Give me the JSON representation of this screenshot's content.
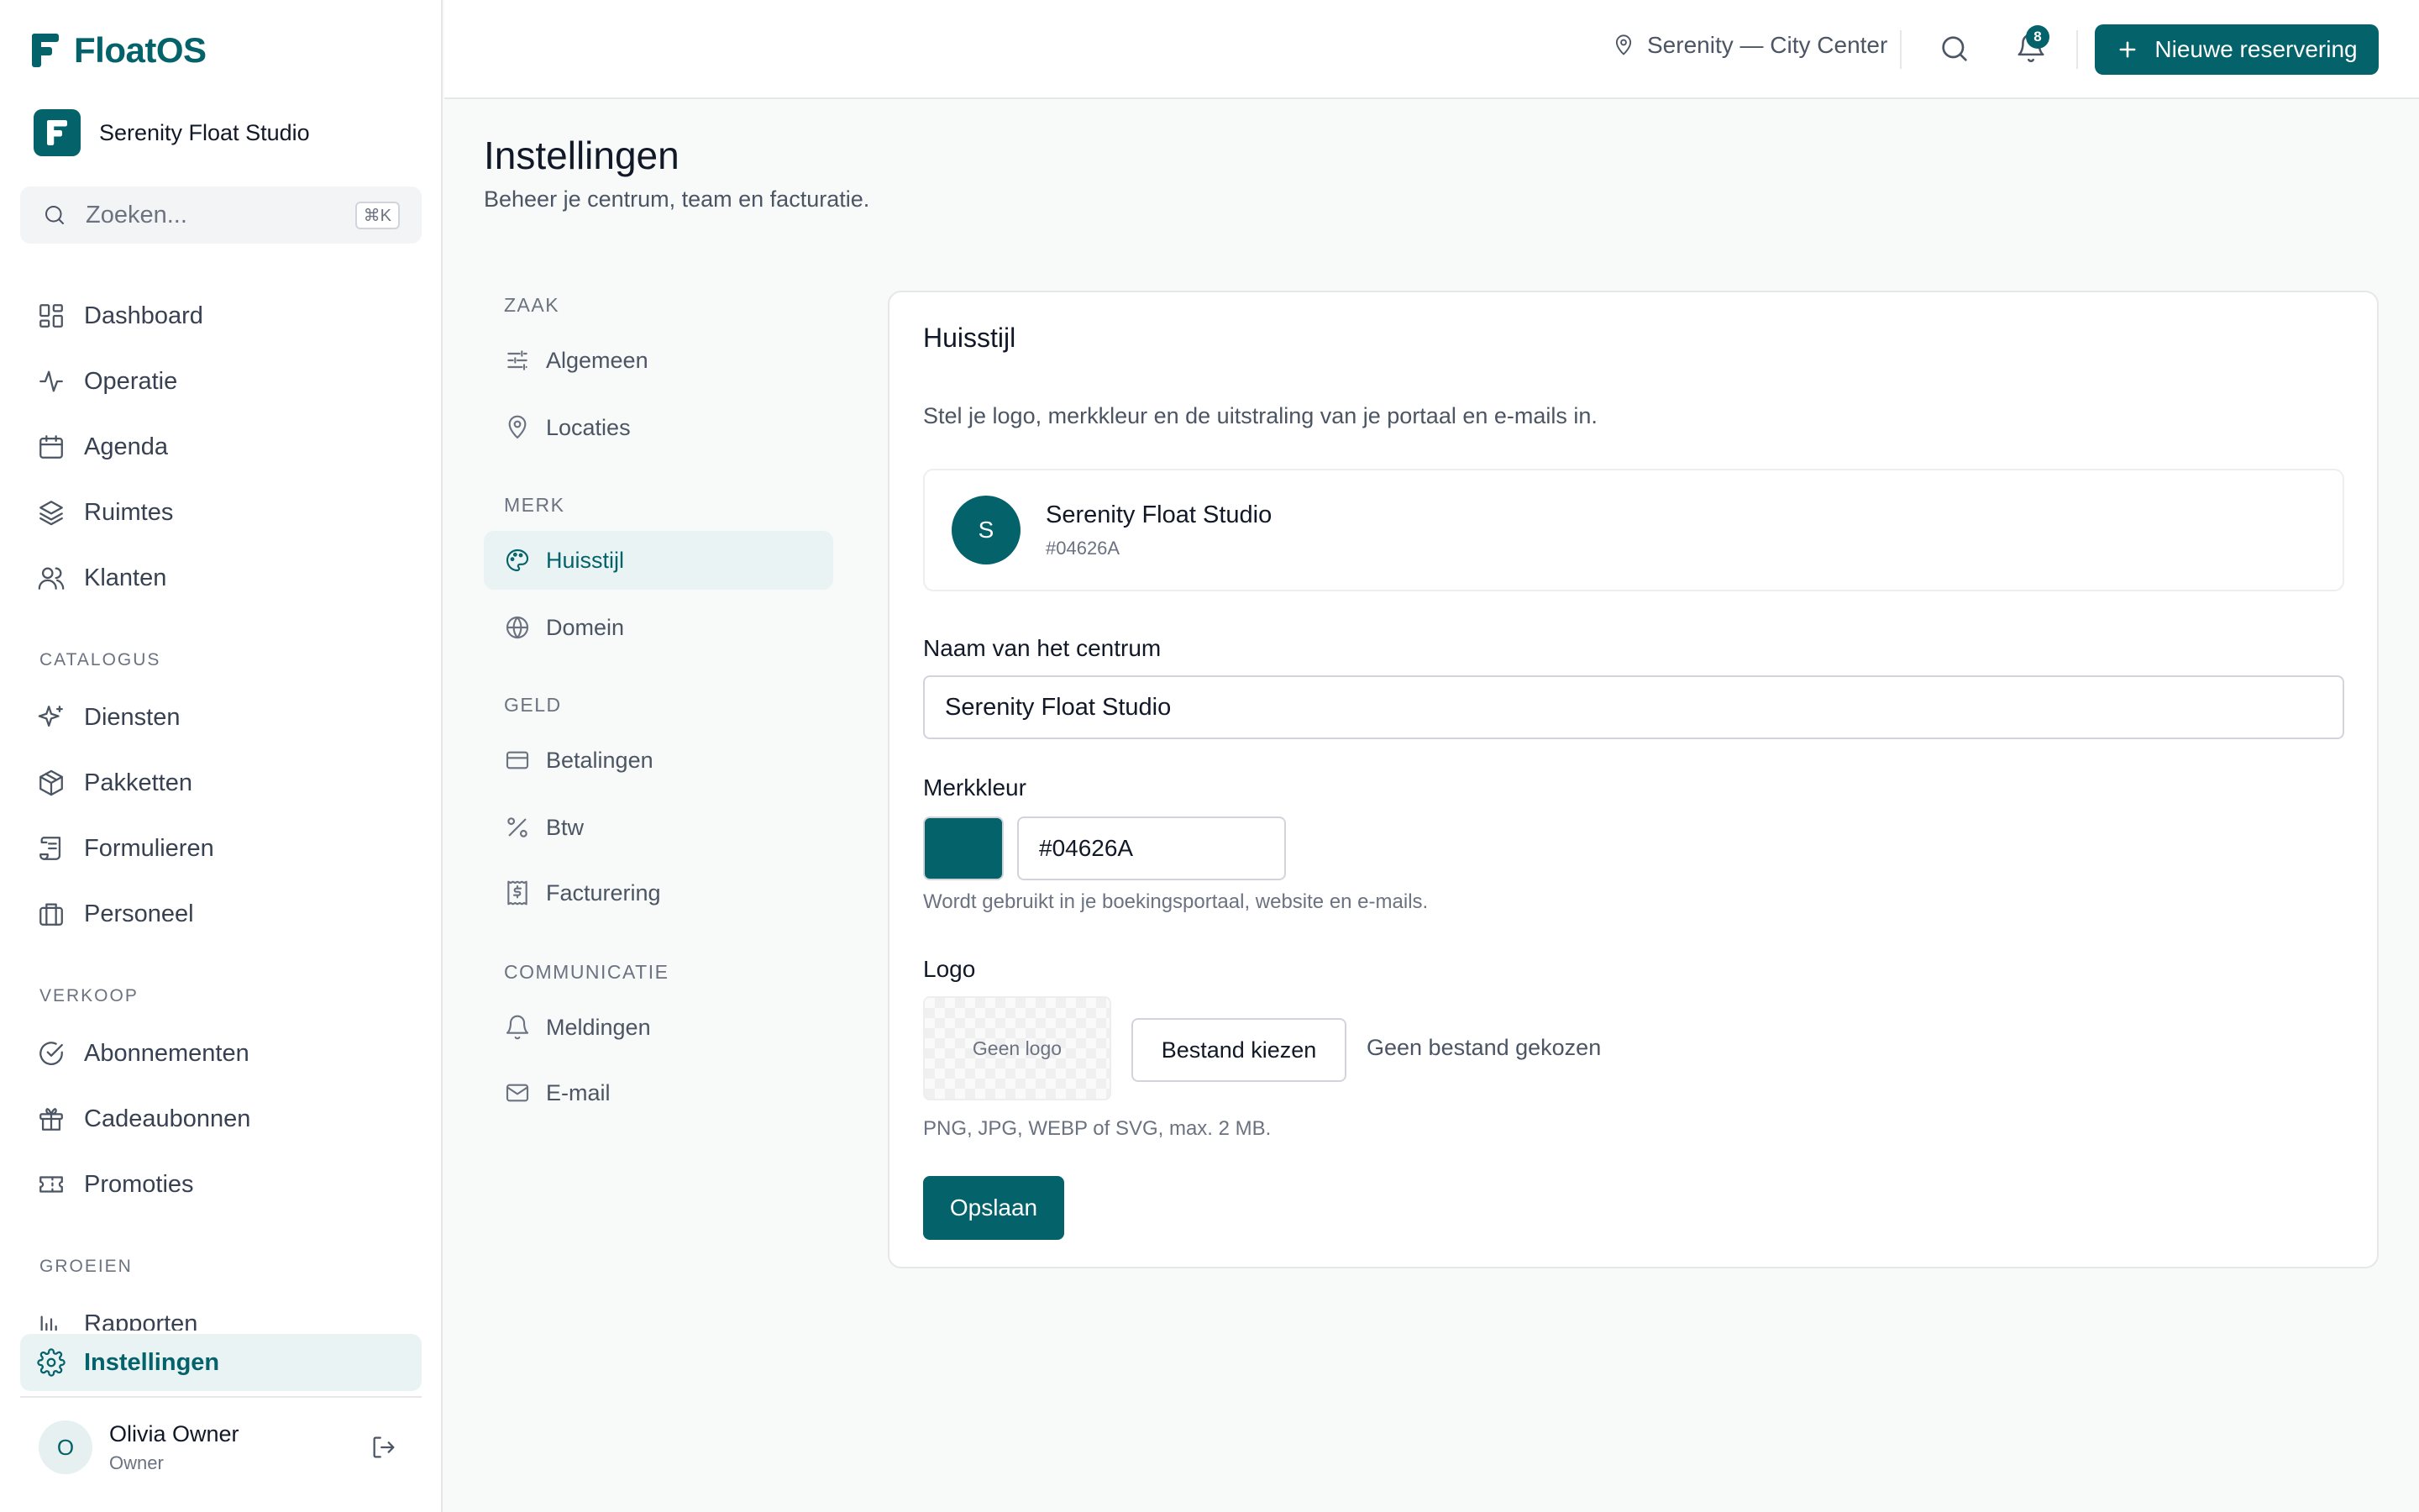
{
  "app": {
    "name": "FloatOS",
    "studio": "Serenity Float Studio"
  },
  "colors": {
    "brand": "#04626A",
    "active_bg": "#eaf3f3"
  },
  "sidebar": {
    "search_placeholder": "Zoeken...",
    "search_shortcut": "⌘K",
    "items": [
      {
        "label": "Dashboard",
        "icon": "dashboard-icon"
      },
      {
        "label": "Operatie",
        "icon": "activity-icon"
      },
      {
        "label": "Agenda",
        "icon": "calendar-icon"
      },
      {
        "label": "Ruimtes",
        "icon": "layers-icon"
      },
      {
        "label": "Klanten",
        "icon": "users-icon"
      }
    ],
    "sections": {
      "catalogus": "CATALOGUS",
      "verkoop": "VERKOOP",
      "groeien": "GROEIEN"
    },
    "catalogus": [
      {
        "label": "Diensten",
        "icon": "sparkles-icon"
      },
      {
        "label": "Pakketten",
        "icon": "package-icon"
      },
      {
        "label": "Formulieren",
        "icon": "scroll-icon"
      },
      {
        "label": "Personeel",
        "icon": "briefcase-icon"
      }
    ],
    "verkoop": [
      {
        "label": "Abonnementen",
        "icon": "check-circle-icon"
      },
      {
        "label": "Cadeaubonnen",
        "icon": "gift-icon"
      },
      {
        "label": "Promoties",
        "icon": "ticket-icon"
      }
    ],
    "groeien": [
      {
        "label": "Rapporten",
        "icon": "bar-chart-icon"
      }
    ],
    "active": {
      "label": "Instellingen",
      "icon": "gear-icon"
    },
    "user": {
      "initial": "O",
      "name": "Olivia Owner",
      "role": "Owner"
    }
  },
  "topbar": {
    "location": "Serenity — City Center",
    "notification_count": "8",
    "new_button": "Nieuwe reservering"
  },
  "page": {
    "title": "Instellingen",
    "subtitle": "Beheer je centrum, team en facturatie."
  },
  "settings_nav": {
    "sections": {
      "zaak": "ZAAK",
      "merk": "MERK",
      "geld": "GELD",
      "communicatie": "COMMUNICATIE"
    },
    "zaak": [
      {
        "label": "Algemeen",
        "icon": "sliders-icon"
      },
      {
        "label": "Locaties",
        "icon": "map-pin-icon"
      }
    ],
    "merk": [
      {
        "label": "Huisstijl",
        "icon": "palette-icon"
      },
      {
        "label": "Domein",
        "icon": "globe-icon"
      }
    ],
    "geld": [
      {
        "label": "Betalingen",
        "icon": "credit-card-icon"
      },
      {
        "label": "Btw",
        "icon": "percent-icon"
      },
      {
        "label": "Facturering",
        "icon": "receipt-icon"
      }
    ],
    "communicatie": [
      {
        "label": "Meldingen",
        "icon": "bell-icon"
      },
      {
        "label": "E-mail",
        "icon": "mail-icon"
      }
    ]
  },
  "card": {
    "title": "Huisstijl",
    "description": "Stel je logo, merkkleur en de uitstraling van je portaal en e-mails in.",
    "preview": {
      "initial": "S",
      "name": "Serenity Float Studio",
      "hex": "#04626A"
    },
    "name_label": "Naam van het centrum",
    "name_value": "Serenity Float Studio",
    "color_label": "Merkkleur",
    "color_value": "#04626A",
    "color_help": "Wordt gebruikt in je boekingsportaal, website en e-mails.",
    "logo_label": "Logo",
    "logo_placeholder": "Geen logo",
    "file_button": "Bestand kiezen",
    "file_status": "Geen bestand gekozen",
    "logo_help": "PNG, JPG, WEBP of SVG, max. 2 MB.",
    "save_button": "Opslaan"
  }
}
